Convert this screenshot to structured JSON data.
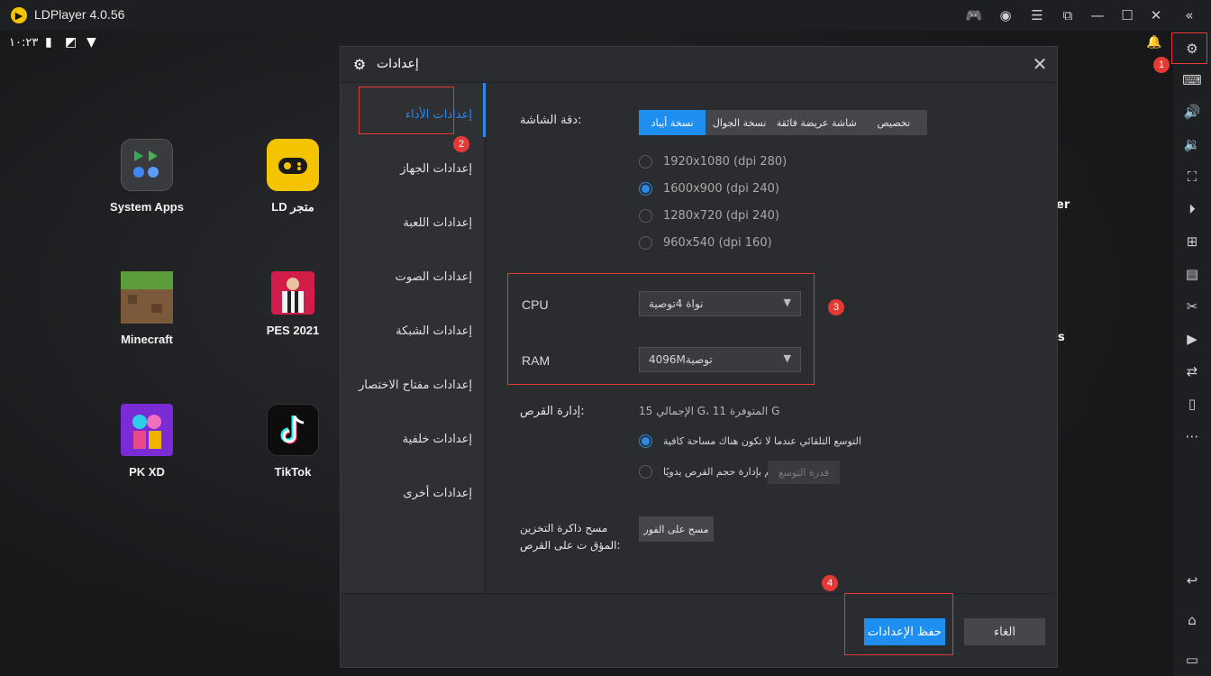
{
  "window": {
    "title": "LDPlayer 4.0.56",
    "controls": [
      "gamepad-icon",
      "account-icon",
      "menu-icon",
      "window-icon",
      "minimize-icon",
      "maximize-icon",
      "close-icon",
      "collapse-icon"
    ]
  },
  "statusbar": {
    "time": "١٠:٢٣"
  },
  "apps": [
    {
      "label": "System Apps"
    },
    {
      "label": "LD متجر"
    },
    {
      "label": "Minecraft"
    },
    {
      "label": "PES 2021"
    },
    {
      "label": "PK XD"
    },
    {
      "label": "TikTok"
    }
  ],
  "partial_labels": {
    "right1": "er",
    "right2": "s"
  },
  "badges": [
    "1",
    "2",
    "3",
    "4"
  ],
  "dialog": {
    "title": "إعدادات",
    "nav": [
      "إعدادات الأداء",
      "إعدادات الجهاز",
      "إعدادات اللعبة",
      "إعدادات الصوت",
      "إعدادات الشبكة",
      "إعدادات مفتاح الاختصار",
      "إعدادات خلفية",
      "إعدادات أخرى"
    ],
    "resolution": {
      "label": "دقة الشاشة:",
      "tabs": [
        "نسخة أيباد",
        "نسخة الجوال",
        "شاشة عريضة فائقة",
        "تخصيص"
      ],
      "selected_tab": "نسخة أيباد",
      "options": [
        "1920x1080  (dpi 280)",
        "1600x900  (dpi 240)",
        "1280x720  (dpi 240)",
        "960x540  (dpi 160)"
      ],
      "selected_option": "1600x900  (dpi 240)"
    },
    "cpu": {
      "label": "CPU",
      "value": "نواة 4توصية"
    },
    "ram": {
      "label": "RAM",
      "value": "4096Mتوصية"
    },
    "disk": {
      "label": "إدارة القرص:",
      "info": "الإجمالي 15 G،  المتوفرة 11 G",
      "option_auto": "التوسع التلقائي عندما لا تكون هناك مساحة كافية",
      "option_manual": "قم بإدارة حجم القرص يدويًا",
      "expand_button": "قدرة التوسع"
    },
    "cache": {
      "label": "مسح ذاكرة التخزين المؤق ت على القرص:",
      "button": "مسح على الفور"
    },
    "save_button": "حفظ الإعدادات",
    "cancel_button": "الغاء"
  }
}
